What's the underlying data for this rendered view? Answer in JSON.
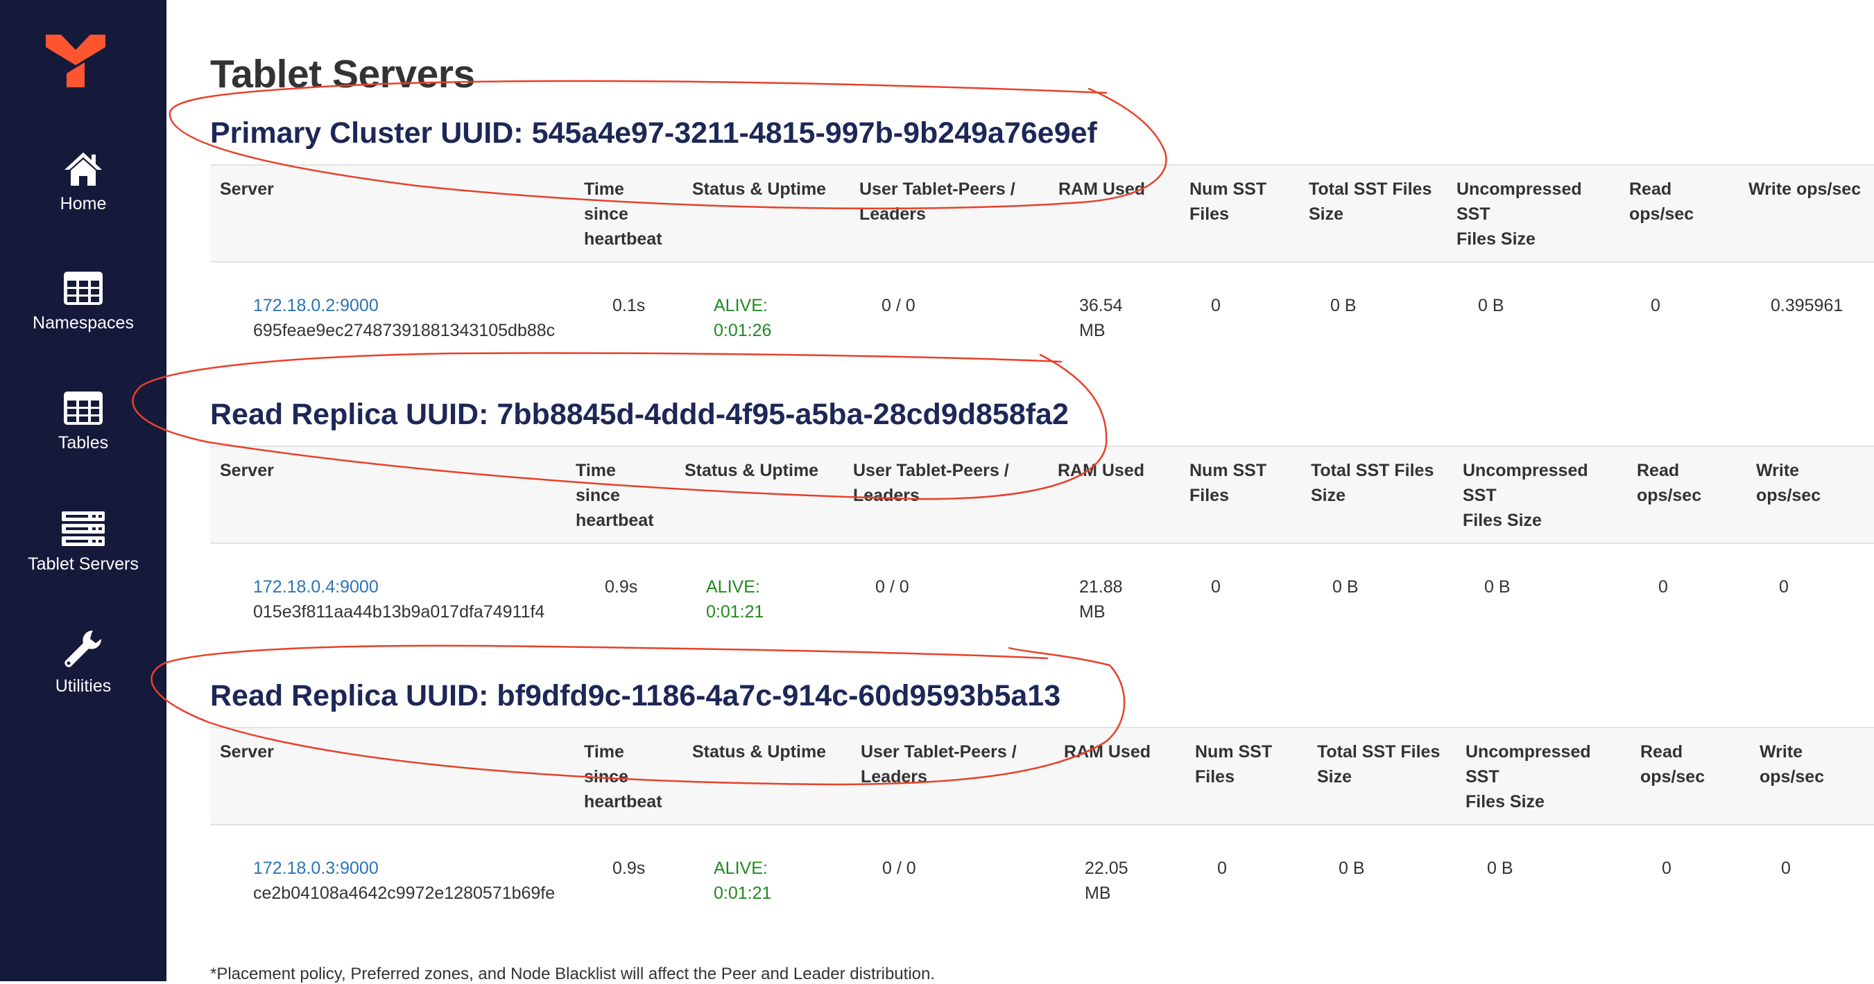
{
  "sidebar": {
    "items": [
      {
        "label": "Home",
        "icon": "home-icon"
      },
      {
        "label": "Namespaces",
        "icon": "table-icon"
      },
      {
        "label": "Tables",
        "icon": "table-icon"
      },
      {
        "label": "Tablet Servers",
        "icon": "server-icon"
      },
      {
        "label": "Utilities",
        "icon": "wrench-icon"
      }
    ],
    "logo_color": "#ff5630",
    "background": "#151a3b"
  },
  "page": {
    "title": "Tablet Servers",
    "footnote": "*Placement policy, Preferred zones, and Node Blacklist will affect the Peer and Leader distribution."
  },
  "clusters": [
    {
      "title": "Primary Cluster UUID: 545a4e97-3211-4815-997b-9b249a76e9ef",
      "headers": [
        "Server",
        "Time\nsince\nheartbeat",
        "Status & Uptime",
        "User Tablet-Peers /\nLeaders",
        "RAM Used",
        "Num SST\nFiles",
        "Total SST Files\nSize",
        "Uncompressed\nSST\nFiles Size",
        "Read\nops/sec",
        "Write ops/sec"
      ],
      "row": {
        "server_link": "172.18.0.2:9000",
        "server_uuid": "695feae9ec27487391881343105db88c",
        "heartbeat": "0.1s",
        "status": "ALIVE:\n0:01:26",
        "peers": "0 / 0",
        "ram": "36.54\nMB",
        "num_sst": "0",
        "total_sst": "0 B",
        "uncompressed_sst": "0 B",
        "read_ops": "0",
        "write_ops": "0.395961"
      }
    },
    {
      "title": "Read Replica UUID: 7bb8845d-4ddd-4f95-a5ba-28cd9d858fa2",
      "headers": [
        "Server",
        "Time\nsince\nheartbeat",
        "Status & Uptime",
        "User Tablet-Peers /\nLeaders",
        "RAM Used",
        "Num SST\nFiles",
        "Total SST Files\nSize",
        "Uncompressed\nSST\nFiles Size",
        "Read\nops/sec",
        "Write\nops/sec"
      ],
      "row": {
        "server_link": "172.18.0.4:9000",
        "server_uuid": "015e3f811aa44b13b9a017dfa74911f4",
        "heartbeat": "0.9s",
        "status": "ALIVE:\n0:01:21",
        "peers": "0 / 0",
        "ram": "21.88\nMB",
        "num_sst": "0",
        "total_sst": "0 B",
        "uncompressed_sst": "0 B",
        "read_ops": "0",
        "write_ops": "0"
      }
    },
    {
      "title": "Read Replica UUID: bf9dfd9c-1186-4a7c-914c-60d9593b5a13",
      "headers": [
        "Server",
        "Time\nsince\nheartbeat",
        "Status & Uptime",
        "User Tablet-Peers /\nLeaders",
        "RAM Used",
        "Num SST\nFiles",
        "Total SST Files\nSize",
        "Uncompressed\nSST\nFiles Size",
        "Read\nops/sec",
        "Write\nops/sec"
      ],
      "row": {
        "server_link": "172.18.0.3:9000",
        "server_uuid": "ce2b04108a4642c9972e1280571b69fe",
        "heartbeat": "0.9s",
        "status": "ALIVE:\n0:01:21",
        "peers": "0 / 0",
        "ram": "22.05\nMB",
        "num_sst": "0",
        "total_sst": "0 B",
        "uncompressed_sst": "0 B",
        "read_ops": "0",
        "write_ops": "0"
      }
    }
  ],
  "colors": {
    "title": "#1d2757",
    "link": "#2b73b6",
    "alive": "#1f8a1f",
    "annotation": "#e8402a"
  }
}
